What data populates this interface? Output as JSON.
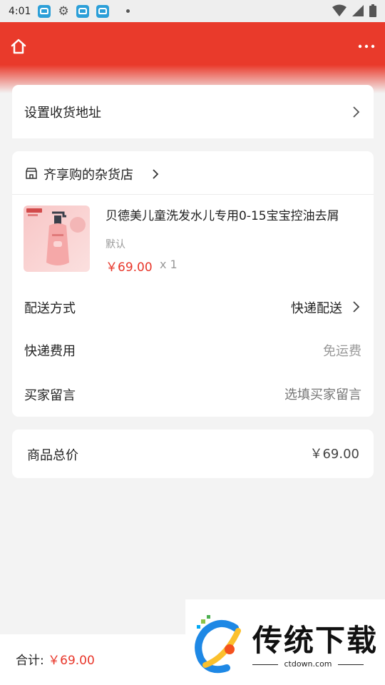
{
  "status_bar": {
    "time": "4:01"
  },
  "header": {
    "home_icon": "home-icon",
    "more_icon": "more-dots-icon"
  },
  "address": {
    "label": "设置收货地址"
  },
  "shop": {
    "name": "齐享购的杂货店",
    "icon": "store-icon"
  },
  "product": {
    "title": "贝德美儿童洗发水儿专用0-15宝宝控油去屑",
    "spec": "默认",
    "price": "￥69.00",
    "qty": "x 1"
  },
  "rows": {
    "delivery_label": "配送方式",
    "delivery_value": "快递配送",
    "fee_label": "快递费用",
    "fee_value": "免运费",
    "message_label": "买家留言",
    "message_placeholder": "选填买家留言"
  },
  "total": {
    "label": "商品总价",
    "value": "￥69.00"
  },
  "bottom": {
    "label": "合计:",
    "amount": "￥69.00"
  },
  "watermark": {
    "title": "传统下载",
    "url": "ctdown.com"
  },
  "colors": {
    "accent": "#e93a2b",
    "price": "#e8362a",
    "placeholder": "#bbbbbb"
  }
}
